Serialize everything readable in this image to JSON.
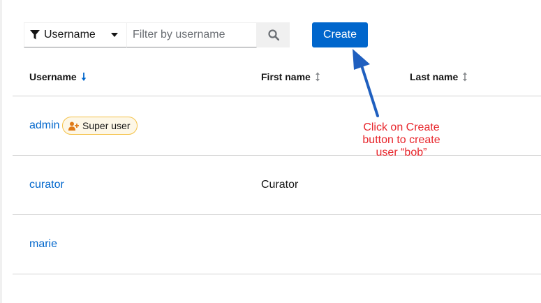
{
  "toolbar": {
    "filter_attribute": "Username",
    "search_placeholder": "Filter by username",
    "search_value": "",
    "create_label": "Create"
  },
  "table": {
    "columns": [
      {
        "label": "Username",
        "sort": "descending"
      },
      {
        "label": "First name",
        "sort": "unsorted"
      },
      {
        "label": "Last name",
        "sort": "unsorted"
      }
    ],
    "rows": [
      {
        "username": "admin",
        "badge": "Super user",
        "first_name": "",
        "last_name": ""
      },
      {
        "username": "curator",
        "badge": "",
        "first_name": "Curator",
        "last_name": ""
      },
      {
        "username": "marie",
        "badge": "",
        "first_name": "",
        "last_name": ""
      }
    ]
  },
  "annotation": {
    "lines": [
      "Click on Create",
      "button to create",
      "user “bob”"
    ],
    "color": "#e8262c",
    "arrow_color": "#1f5fbf"
  },
  "icons": {
    "filter": "filter-funnel-icon",
    "dropdown": "caret-down-icon",
    "search": "magnifier-icon",
    "sort_active": "sort-down-arrow-icon",
    "sort_inactive": "sort-updown-icon",
    "super_user": "user-plus-icon"
  },
  "colors": {
    "primary": "#0066cc",
    "badge_border": "#f4c145",
    "badge_bg": "#fdf7e7",
    "divider": "#d2d2d2"
  }
}
